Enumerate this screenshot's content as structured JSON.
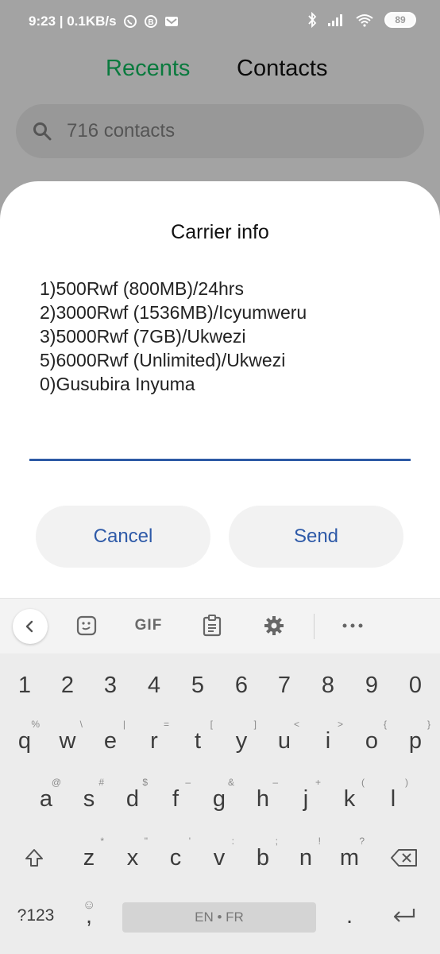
{
  "status_bar": {
    "time_speed": "9:23 | 0.1KB/s",
    "notification_icons": [
      "whatsapp-icon",
      "b-badge-icon",
      "gmail-icon"
    ],
    "right_icons": [
      "bluetooth-icon",
      "signal-icon",
      "wifi-icon",
      "battery-icon"
    ],
    "battery_level": "89"
  },
  "app": {
    "tabs": [
      {
        "label": "Recents",
        "active": true,
        "color": "#0a7a3e"
      },
      {
        "label": "Contacts",
        "active": false
      }
    ],
    "search": {
      "placeholder": "716 contacts",
      "icon": "search-icon"
    }
  },
  "dialog": {
    "title": "Carrier info",
    "lines": [
      "1)500Rwf (800MB)/24hrs",
      "2)3000Rwf (1536MB)/Icyumweru",
      "3)5000Rwf (7GB)/Ukwezi",
      "5)6000Rwf (Unlimited)/Ukwezi",
      "0)Gusubira Inyuma"
    ],
    "input_value": "",
    "cancel_label": "Cancel",
    "send_label": "Send",
    "accent_color": "#2e5aa8"
  },
  "keyboard": {
    "toolbar": {
      "gif_label": "GIF",
      "icons": [
        "back-chevron-icon",
        "sticker-icon",
        "gif-icon",
        "clipboard-icon",
        "settings-icon",
        "more-icon"
      ]
    },
    "number_row": [
      "1",
      "2",
      "3",
      "4",
      "5",
      "6",
      "7",
      "8",
      "9",
      "0"
    ],
    "row1": [
      {
        "key": "q",
        "hint": "%"
      },
      {
        "key": "w",
        "hint": "\\"
      },
      {
        "key": "e",
        "hint": "|"
      },
      {
        "key": "r",
        "hint": "="
      },
      {
        "key": "t",
        "hint": "["
      },
      {
        "key": "y",
        "hint": "]"
      },
      {
        "key": "u",
        "hint": "<"
      },
      {
        "key": "i",
        "hint": ">"
      },
      {
        "key": "o",
        "hint": "{"
      },
      {
        "key": "p",
        "hint": "}"
      }
    ],
    "row2": [
      {
        "key": "a",
        "hint": "@"
      },
      {
        "key": "s",
        "hint": "#"
      },
      {
        "key": "d",
        "hint": "$"
      },
      {
        "key": "f",
        "hint": "–"
      },
      {
        "key": "g",
        "hint": "&"
      },
      {
        "key": "h",
        "hint": "–"
      },
      {
        "key": "j",
        "hint": "+"
      },
      {
        "key": "k",
        "hint": "("
      },
      {
        "key": "l",
        "hint": ")"
      }
    ],
    "row3": [
      {
        "key": "z",
        "hint": "*"
      },
      {
        "key": "x",
        "hint": "\""
      },
      {
        "key": "c",
        "hint": "'"
      },
      {
        "key": "v",
        "hint": ":"
      },
      {
        "key": "b",
        "hint": ";"
      },
      {
        "key": "n",
        "hint": "!"
      },
      {
        "key": "m",
        "hint": "?"
      }
    ],
    "symbols_label": "?123",
    "comma_label": ",",
    "emoji_hint": "☺",
    "space_label": "EN • FR",
    "period_label": "."
  }
}
